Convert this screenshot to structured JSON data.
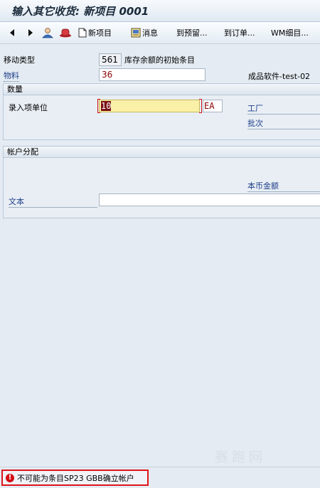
{
  "window": {
    "title": "输入其它收货: 新项目 0001"
  },
  "toolbar": {
    "new_item": "新项目",
    "message": "消息",
    "to_reservation": "到预留...",
    "to_order": "到订单...",
    "wm_detail": "WM细目..."
  },
  "header": {
    "movement_type_label": "移动类型",
    "movement_type_value": "561",
    "movement_type_desc": "库存余额的初始条目",
    "material_label": "物料",
    "material_value": "36",
    "material_desc": "成品软件-test-02"
  },
  "quantity_group": {
    "title": "数量",
    "entry_unit_label": "录入项单位",
    "entry_qty_value": "10",
    "entry_unit_value": "EA",
    "plant_label": "工厂",
    "batch_label": "批次"
  },
  "account_group": {
    "title": "帐户分配",
    "local_amount_label": "本币金额",
    "text_label": "文本",
    "text_value": ""
  },
  "status": {
    "message": "不可能为条目SP23 GBB确立帐户"
  },
  "watermark": "赛跑网",
  "colors": {
    "background": "#e4ebf2",
    "required_border": "#d0121b",
    "error": "#d31016",
    "highlight_input": "#fbf0a8"
  }
}
